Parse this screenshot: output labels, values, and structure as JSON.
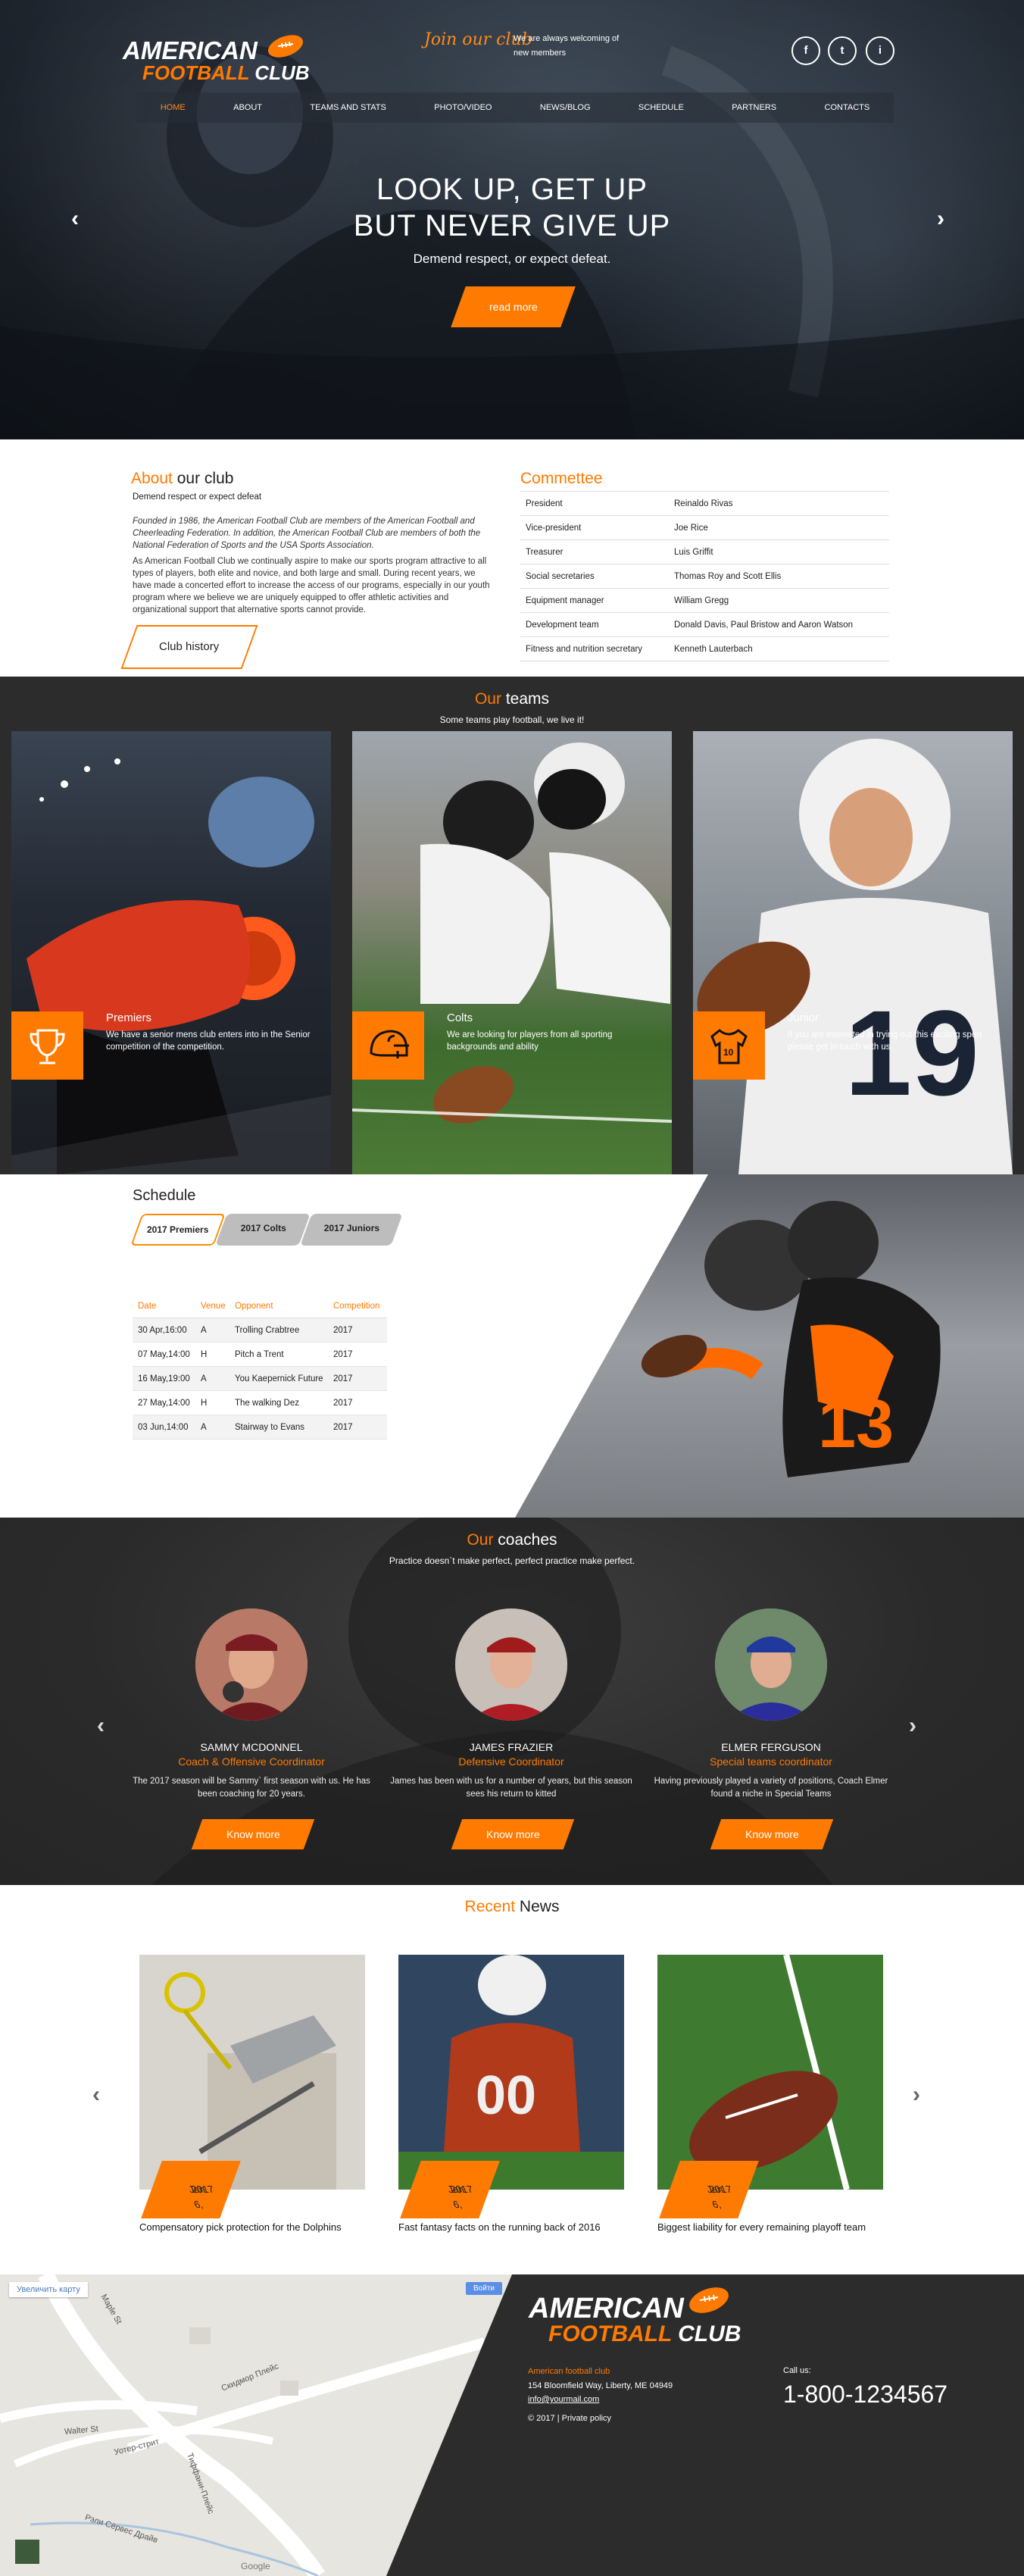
{
  "brand": {
    "line1": "AMERICAN",
    "line2a": "FOOTBALL",
    "line2b": "CLUB"
  },
  "header": {
    "join": "Join our club",
    "welcome": "We are always welcoming of new members",
    "social": [
      "f",
      "t",
      "i"
    ]
  },
  "nav": [
    "HOME",
    "ABOUT",
    "TEAMS AND STATS",
    "PHOTO/VIDEO",
    "NEWS/BLOG",
    "SCHEDULE",
    "PARTNERS",
    "CONTACTS"
  ],
  "hero": {
    "title1": "LOOK UP, GET UP",
    "title2": "BUT NEVER GIVE UP",
    "subtitle": "Demend respect, or expect defeat.",
    "button": "read more",
    "prev": "‹",
    "next": "›"
  },
  "about": {
    "title_a": "About",
    "title_b": " our club",
    "lead": "Demend respect or expect defeat",
    "p1": "Founded in 1986, the American Football Club are members of the American Football and Cheerleading Federation. In addition, the American Football Club are members of both the National Federation of Sports and the USA Sports Association.",
    "p2": "As American Football Club we continually aspire to make our sports program attractive to all types of players, both elite and novice, and both large and small. During recent years, we have made a concerted effort to increase the access of our programs, especially in our youth program where we believe we are uniquely equipped to offer athletic activities and organizational support that alternative sports cannot provide.",
    "button": "Club history"
  },
  "committee": {
    "title": "Commettee",
    "rows": [
      {
        "role": "President",
        "name": "Reinaldo Rivas"
      },
      {
        "role": "Vice-president",
        "name": "Joe Rice"
      },
      {
        "role": "Treasurer",
        "name": "Luis Griffit"
      },
      {
        "role": "Social secretaries",
        "name": "Thomas Roy and Scott Ellis"
      },
      {
        "role": "Equipment manager",
        "name": "William Gregg"
      },
      {
        "role": "Development team",
        "name": "Donald Davis, Paul Bristow and Aaron Watson"
      },
      {
        "role": "Fitness and nutrition secretary",
        "name": "Kenneth Lauterbach"
      }
    ]
  },
  "teams": {
    "title_a": "Our",
    "title_b": " teams",
    "subtitle": "Some teams play football, we live it!",
    "items": [
      {
        "name": "Premiers",
        "desc": "We have a senior mens club enters into in the Senior competition of the competition.",
        "icon": "trophy-icon"
      },
      {
        "name": "Colts",
        "desc": "We are looking for players from all sporting backgrounds and ability",
        "icon": "helmet-icon"
      },
      {
        "name": "Junior",
        "desc": "If you are interested in trying out this exciting sport please get in touch with us.",
        "icon": "jersey-icon"
      }
    ]
  },
  "schedule": {
    "title": "Schedule",
    "tabs": [
      "2017 Premiers",
      "2017 Colts",
      "2017 Juniors"
    ],
    "headers": [
      "Date",
      "Venue",
      "Opponent",
      "Competition"
    ],
    "rows": [
      [
        "30 Apr,16:00",
        "A",
        "Trolling Crabtree",
        "2017"
      ],
      [
        "07 May,14:00",
        "H",
        "Pitch a Trent",
        "2017"
      ],
      [
        "16 May,19:00",
        "A",
        "You Kaepernick Future",
        "2017"
      ],
      [
        "27 May,14:00",
        "H",
        "The walking Dez",
        "2017"
      ],
      [
        "03 Jun,14:00",
        "A",
        "Stairway to Evans",
        "2017"
      ]
    ]
  },
  "coaches": {
    "title_a": "Our",
    "title_b": " coaches",
    "subtitle": "Practice doesn`t make perfect, perfect practice make perfect.",
    "items": [
      {
        "name": "SAMMY MCDONNEL",
        "role": "Coach & Offensive Coordinator",
        "desc": "The 2017 season will be Sammy` first season with us. He has been coaching for 20 years.",
        "button": "Know more"
      },
      {
        "name": "JAMES FRAZIER",
        "role": "Defensive Coordinator",
        "desc": "James has been with us for a number of years, but this season sees his return to kitted",
        "button": "Know more"
      },
      {
        "name": "ELMER FERGUSON",
        "role": "Special teams coordinator",
        "desc": "Having previously played a variety of positions, Coach Elmer found a niche in Special Teams",
        "button": "Know more"
      }
    ]
  },
  "news": {
    "title_a": "Recent",
    "title_b": " News",
    "items": [
      {
        "date1": "Jan 6,",
        "date2": "2017",
        "caption": "Compensatory pick protection for the Dolphins"
      },
      {
        "date1": "Jan 6,",
        "date2": "2017",
        "caption": "Fast fantasy facts on the running back of 2016"
      },
      {
        "date1": "Jan 6,",
        "date2": "2017",
        "caption": "Biggest liability for every remaining playoff team"
      }
    ]
  },
  "map": {
    "zoom_link": "Увеличить карту",
    "signin": "Войти",
    "streets": [
      "Maple St",
      "Скидмор Плейс",
      "Walter St",
      "Уотер-стрит",
      "Тиффани-Плейс",
      "Рэли Сёрвес Драйв"
    ],
    "google": "Google"
  },
  "footer": {
    "club": "American football club",
    "address": "154 Bloomfield Way, Liberty, ME 04949",
    "email": "info@yourmail.com",
    "copy": "© 2017 | Private policy",
    "call_label": "Call us:",
    "phone": "1-800-1234567"
  },
  "colors": {
    "accent": "#ff7a00",
    "dark": "#2c2c2c"
  }
}
